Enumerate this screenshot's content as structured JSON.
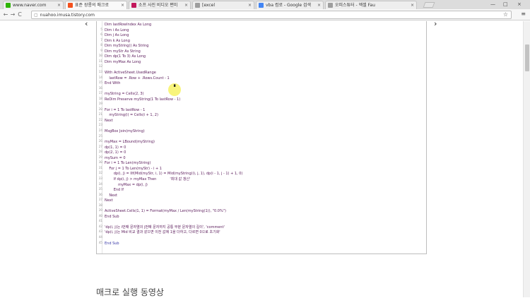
{
  "tabs": [
    {
      "label": "www.naver.com",
      "fav": "#2db400"
    },
    {
      "label": "표준 장롱의 매크로",
      "fav": "#f4511e"
    },
    {
      "label": "소프 사진 비디오 편미",
      "fav": "#c2185b"
    },
    {
      "label": "[excel",
      "fav": "#9e9e9e"
    },
    {
      "label": "vba 컴로 - Google 검색",
      "fav": "#4285f4"
    },
    {
      "label": "오피스튜터 - 엑셀 Fau",
      "fav": "#9e9e9e"
    }
  ],
  "tab_close": "×",
  "window_controls": {
    "minimize": "—",
    "maximize": "□",
    "close": "×"
  },
  "toolbar": {
    "back": "←",
    "forward": "→",
    "reload": "C",
    "menu": "≡"
  },
  "address": {
    "url": "nuahoo.imusa.tistory.com",
    "star": "☆"
  },
  "slider": {
    "prev": "‹",
    "next": "›"
  },
  "code_lines": [
    {
      "n": "",
      "t": "Dim lastRowIndex As Long"
    },
    {
      "n": "5",
      "t": "Dim i As Long"
    },
    {
      "n": "6",
      "t": "Dim j As Long"
    },
    {
      "n": "7",
      "t": "Dim k As Long"
    },
    {
      "n": "8",
      "t": "Dim myString() As String"
    },
    {
      "n": "9",
      "t": "Dim myStr As String"
    },
    {
      "n": "10",
      "t": "Dim dp(1 To 3) As Long"
    },
    {
      "n": "11",
      "t": "Dim myMax As Long"
    },
    {
      "n": "12",
      "t": ""
    },
    {
      "n": "13",
      "t": "With ActiveSheet.UsedRange"
    },
    {
      "n": "14",
      "t": "    lastRow = .Row + .Rows.Count - 1"
    },
    {
      "n": "15",
      "t": "End With"
    },
    {
      "n": "16",
      "t": ""
    },
    {
      "n": "17",
      "t": "myString = Cells(2, 3)"
    },
    {
      "n": "18",
      "t": "ReDim Preserve myString(1 To lastRow - 1)"
    },
    {
      "n": "19",
      "t": ""
    },
    {
      "n": "20",
      "t": "For i = 1 To lastRow - 1"
    },
    {
      "n": "21",
      "t": "    myString(i) = Cells(i + 1, 2)"
    },
    {
      "n": "22",
      "t": "Next"
    },
    {
      "n": "23",
      "t": ""
    },
    {
      "n": "24",
      "t": "MsgBox Join(myString)"
    },
    {
      "n": "25",
      "t": ""
    },
    {
      "n": "26",
      "t": "myMax = LBound(myString)"
    },
    {
      "n": "27",
      "t": "dp(1, 1) = 0"
    },
    {
      "n": "28",
      "t": "dp(2, 1) = 0"
    },
    {
      "n": "29",
      "t": "mySum = 0"
    },
    {
      "n": "30",
      "t": "For i = 1 To Len(myString)"
    },
    {
      "n": "31",
      "t": "    For j = 1 To Len(myStr) - i + 1"
    },
    {
      "n": "32",
      "t": "        dp(i, j) = IIf(Mid(myStr, i, 1) = Mid(myString(i), j, 1), dp(i - 1, j - 1) + 1, 0)"
    },
    {
      "n": "33",
      "t": "        If dp(i, j) > myMax Then            '최대 값 갱신'"
    },
    {
      "n": "34",
      "t": "            myMax = dp(i, j)"
    },
    {
      "n": "35",
      "t": "        End If"
    },
    {
      "n": "36",
      "t": "    Next"
    },
    {
      "n": "37",
      "t": "Next"
    },
    {
      "n": "38",
      "t": ""
    },
    {
      "n": "39",
      "t": "ActiveSheet.Cells(1, 1) = Format(myMax / Len(myString(1)), \"0.0%\")"
    },
    {
      "n": "40",
      "t": "End Sub"
    },
    {
      "n": "41",
      "t": ""
    },
    {
      "n": "42",
      "t": "'dp(i, j)는 i번째 문자열의 j번째 문자까지 공통 부분 문자열의 길이', 'comment'"
    },
    {
      "n": "43",
      "t": "'dp(i, j)는 Mid 비교 결과 같으면 이전 값에 1을 더하고, 다르면 0으로 초기화'"
    },
    {
      "n": "44",
      "t": ""
    },
    {
      "n": "45",
      "t": "End Sub"
    }
  ],
  "heading": "매크로 실행 동영상"
}
